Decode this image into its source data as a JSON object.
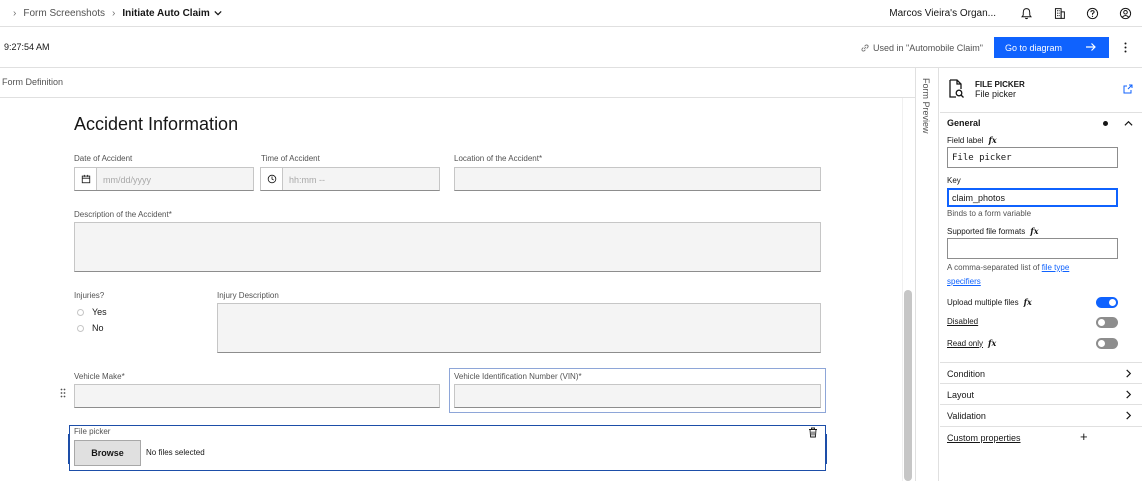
{
  "topbar": {
    "breadcrumb": [
      {
        "label": "Form Screenshots"
      },
      {
        "label": "Initiate Auto Claim"
      }
    ],
    "org": "Marcos Vieira's Organ..."
  },
  "toolbar": {
    "time": "9:27:54 AM",
    "used_in": "Used in \"Automobile Claim\"",
    "goto_label": "Go to diagram"
  },
  "subheader": {
    "label": "Form Definition"
  },
  "form": {
    "title": "Accident Information",
    "date_label": "Date of Accident",
    "date_placeholder": "mm/dd/yyyy",
    "time_label": "Time of Accident",
    "time_placeholder": "hh:mm --",
    "location_label": "Location of the Accident*",
    "description_label": "Description of the Accident*",
    "injuries_label": "Injuries?",
    "injuries_options": [
      "Yes",
      "No"
    ],
    "injury_desc_label": "Injury Description",
    "vehicle_make_label": "Vehicle Make*",
    "vin_label": "Vehicle Identification Number (VIN)*",
    "file_picker_label": "File picker",
    "browse_label": "Browse",
    "no_files": "No files selected"
  },
  "preview": {
    "label": "Form Preview"
  },
  "panel": {
    "type": "FILE PICKER",
    "name": "File picker",
    "general": "General",
    "field_label_label": "Field label",
    "field_label_value": "File picker",
    "key_label": "Key",
    "key_value": "claim_photos",
    "key_helper": "Binds to a form variable",
    "formats_label": "Supported file formats",
    "formats_helper_prefix": "A comma-separated list of",
    "formats_helper_link1": "file type",
    "formats_helper_link2": "specifiers",
    "upload_multiple": "Upload multiple files",
    "upload_multiple_on": true,
    "disabled": "Disabled",
    "read_only": "Read only",
    "fx": "fx",
    "sections": [
      "Condition",
      "Layout",
      "Validation"
    ],
    "custom_properties": "Custom properties"
  }
}
